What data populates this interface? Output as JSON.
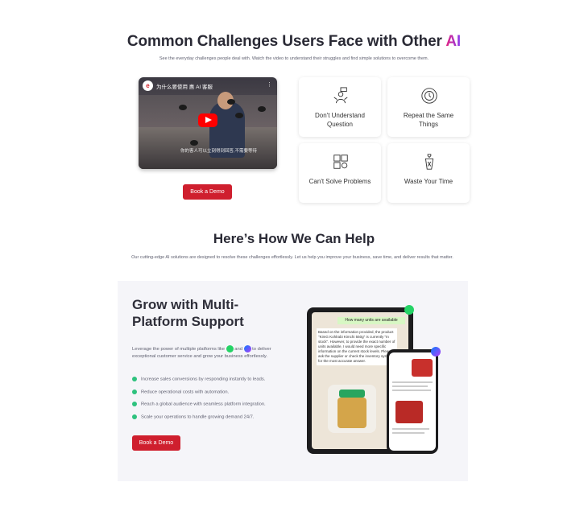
{
  "section1": {
    "title_main": "Common Challenges Users Face with Other ",
    "title_accent": "AI",
    "subtitle": "See the everyday challenges people deal with. Watch the video to understand their struggles and find simple solutions to overcome them.",
    "video": {
      "title": "为什么要使用 惠 AI 客服",
      "caption": "你的客人可以立刻得到回答,不需要等待"
    },
    "button": "Book a Demo",
    "cards": [
      {
        "icon": "confused-person-icon",
        "label_1": "Don't Understand",
        "label_2": "Question"
      },
      {
        "icon": "repeat-cycle-icon",
        "label_1": "Repeat the Same",
        "label_2": "Things"
      },
      {
        "icon": "puzzle-gear-icon",
        "label_1": "Can't Solve Problems",
        "label_2": ""
      },
      {
        "icon": "hourglass-trash-icon",
        "label_1": "Waste Your Time",
        "label_2": ""
      }
    ]
  },
  "section2": {
    "title": "Here’s How We Can Help",
    "subtitle": "Our cutting-edge AI solutions are designed to resolve these challenges effortlessly. Let us help you improve your business, save time, and deliver results that matter."
  },
  "panel": {
    "title": "Grow with Multi-Platform Support",
    "text_before": "Leverage the power of multiple platforms like ",
    "text_mid": " and ",
    "text_after": " to deliver exceptional customer service and grow your business effortlessly.",
    "bullets": [
      "Increase sales conversions by responding instantly to leads.",
      "Reduce operational costs with automation.",
      "Reach a global audience with seamless platform integration.",
      "Scale your operations to handle growing demand 24/7."
    ],
    "button": "Book a Demo",
    "tablet": {
      "question": "How many units are available",
      "answer": "Based on the information provided, the product \"KimG Kohlrabi Kimchi 550g\" is currently \"In stock\". However, to provide the exact number of units available, I would need more specific information on the current stock levels. Please ask the supplier or check the inventory system for the most accurate answer."
    },
    "phone": {
      "text": "Great news! I found the item matching the image you uploaded."
    }
  },
  "colors": {
    "accent_red": "#cf1f2e",
    "whatsapp_green": "#25d366",
    "panel_bg": "#f5f5f9"
  }
}
